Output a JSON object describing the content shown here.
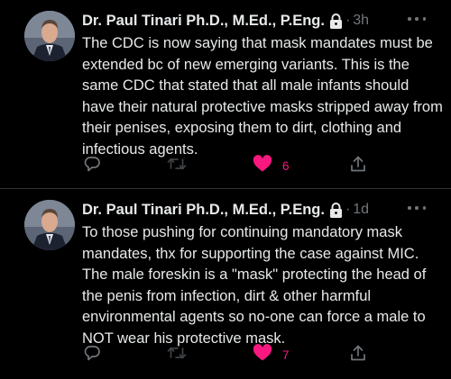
{
  "tweets": [
    {
      "author": "Dr. Paul Tinari Ph.D., M.Ed., P.Eng.",
      "time": "3h",
      "text": "The CDC is now saying that mask mandates must be extended bc of new emerging variants.  This is the same CDC that stated that all male infants should have their natural protective masks stripped away from their penises, exposing them to dirt, clothing and infectious agents.",
      "likes": "6",
      "liked": true
    },
    {
      "author": "Dr. Paul Tinari Ph.D., M.Ed., P.Eng.",
      "time": "1d",
      "text": "To those pushing for continuing mandatory mask mandates, thx for supporting the case against MIC. The male foreskin is a \"mask\" protecting the head of the penis from infection, dirt & other harmful environmental agents so no-one can force a male to NOT wear his protective mask.",
      "likes": "7",
      "liked": true
    }
  ],
  "ui": {
    "separator": "·"
  },
  "colors": {
    "background": "#000000",
    "text": "#e7e9ea",
    "muted": "#71767b",
    "like": "#f91880",
    "divider": "#2f3336"
  },
  "icons": [
    "lock-icon",
    "more-icon",
    "reply-icon",
    "retweet-icon",
    "heart-icon",
    "share-icon"
  ]
}
